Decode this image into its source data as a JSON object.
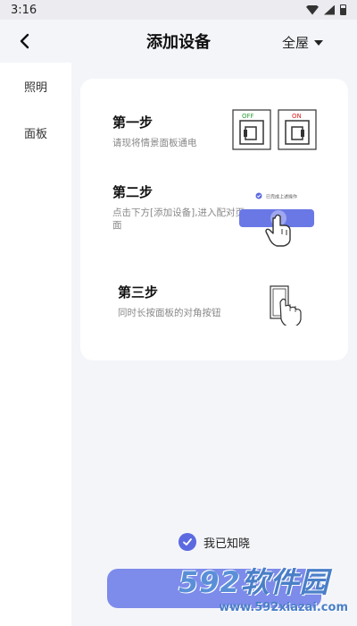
{
  "status_bar": {
    "time": "3:16"
  },
  "header": {
    "title": "添加设备",
    "scope": "全屋"
  },
  "sidebar": {
    "items": [
      {
        "label": "照明"
      },
      {
        "label": "面板"
      }
    ]
  },
  "steps": [
    {
      "title": "第一步",
      "desc": "请现将情景面板通电"
    },
    {
      "title": "第二步",
      "desc": "点击下方[添加设备],进入配对页面"
    },
    {
      "title": "第三步",
      "desc": "同时长按面板的对角按钮"
    }
  ],
  "illustration": {
    "switch_off_label": "OFF",
    "switch_on_label": "ON",
    "confirm_hint": "已完成上述操作"
  },
  "confirm": {
    "label": "我已知晓",
    "checked": true
  },
  "watermark": {
    "brand": "592软件园",
    "url": "www.592xiazai.com"
  },
  "colors": {
    "accent": "#5b6ae0",
    "button": "#7d8bea",
    "off": "#2e9e3a",
    "on": "#d22"
  }
}
